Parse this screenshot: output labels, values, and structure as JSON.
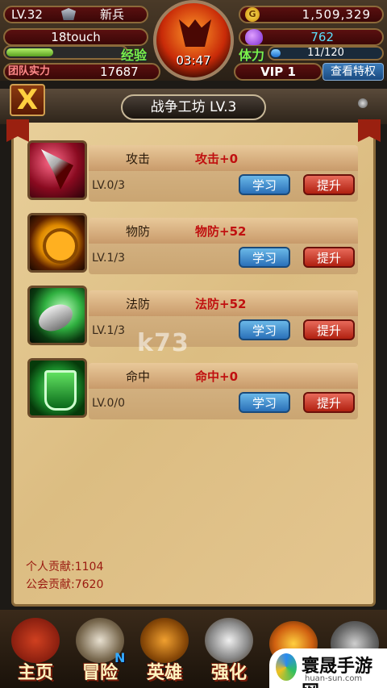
{
  "hud": {
    "level": "LV.32",
    "rank": "新兵",
    "player_name": "18touch",
    "exp_label": "经验",
    "exp_progress": 0.4,
    "team_power_label": "团队实力",
    "team_power": "17687",
    "timer": "03:47",
    "gold": "1,509,329",
    "gold_icon_letter": "G",
    "gems": "762",
    "stamina_label": "体力",
    "stamina": "11/120",
    "stamina_progress": 0.09,
    "vip": "VIP 1",
    "vip_button": "查看特权"
  },
  "panel": {
    "close_label": "X",
    "title": "战争工坊 LV.3"
  },
  "skills": [
    {
      "name": "攻击",
      "bonus": "攻击+0",
      "level": "LV.0/3",
      "learn": "学习",
      "upgrade": "提升",
      "icon": "axe-icon"
    },
    {
      "name": "物防",
      "bonus": "物防+52",
      "level": "LV.1/3",
      "learn": "学习",
      "upgrade": "提升",
      "icon": "shield-coin-icon"
    },
    {
      "name": "法防",
      "bonus": "法防+52",
      "level": "LV.1/3",
      "learn": "学习",
      "upgrade": "提升",
      "icon": "magic-shield-icon"
    },
    {
      "name": "命中",
      "bonus": "命中+0",
      "level": "LV.0/0",
      "learn": "学习",
      "upgrade": "提升",
      "icon": "green-shield-icon"
    }
  ],
  "contribution": {
    "personal": "个人贡献:1104",
    "guild": "公会贡献:7620"
  },
  "watermark": "k73",
  "nav": [
    {
      "label": "主页",
      "icon": "home-icon"
    },
    {
      "label": "冒险",
      "icon": "skull-icon",
      "badge": "N"
    },
    {
      "label": "英雄",
      "icon": "hero-helmet-icon"
    },
    {
      "label": "强化",
      "icon": "anvil-hammer-icon"
    }
  ],
  "brand": {
    "name": "寰晟手游网",
    "url": "huan-sun.com"
  },
  "colors": {
    "bonus_red": "#c01010",
    "learn_blue": "#2a70b8",
    "upgrade_red": "#b02010",
    "parchment": "#dcbd82"
  }
}
